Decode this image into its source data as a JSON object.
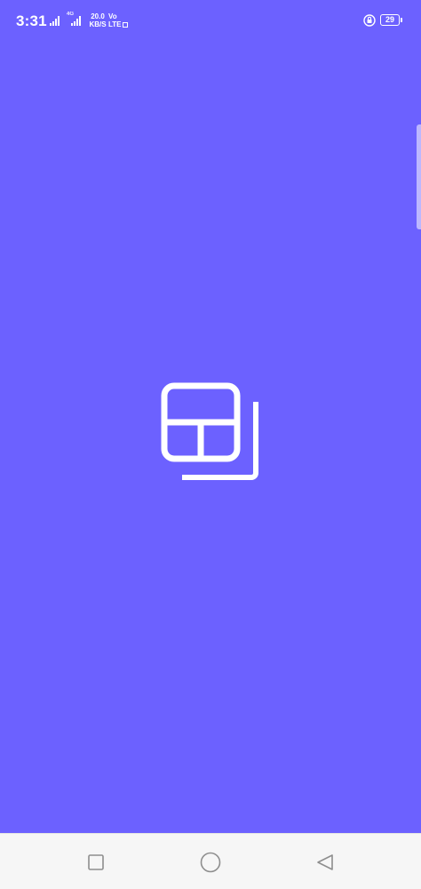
{
  "status_bar": {
    "time": "3:31",
    "network_type_1": "4G",
    "network_speed_value": "20.0",
    "network_speed_unit": "KB/S",
    "volte_top": "Vo",
    "volte_bottom": "LTE",
    "battery_level": "29"
  },
  "splash": {
    "background_color": "#6C61FF",
    "logo_icon": "layout-gallery-icon"
  },
  "nav_bar": {
    "recents_icon": "square-icon",
    "home_icon": "circle-icon",
    "back_icon": "triangle-back-icon"
  }
}
